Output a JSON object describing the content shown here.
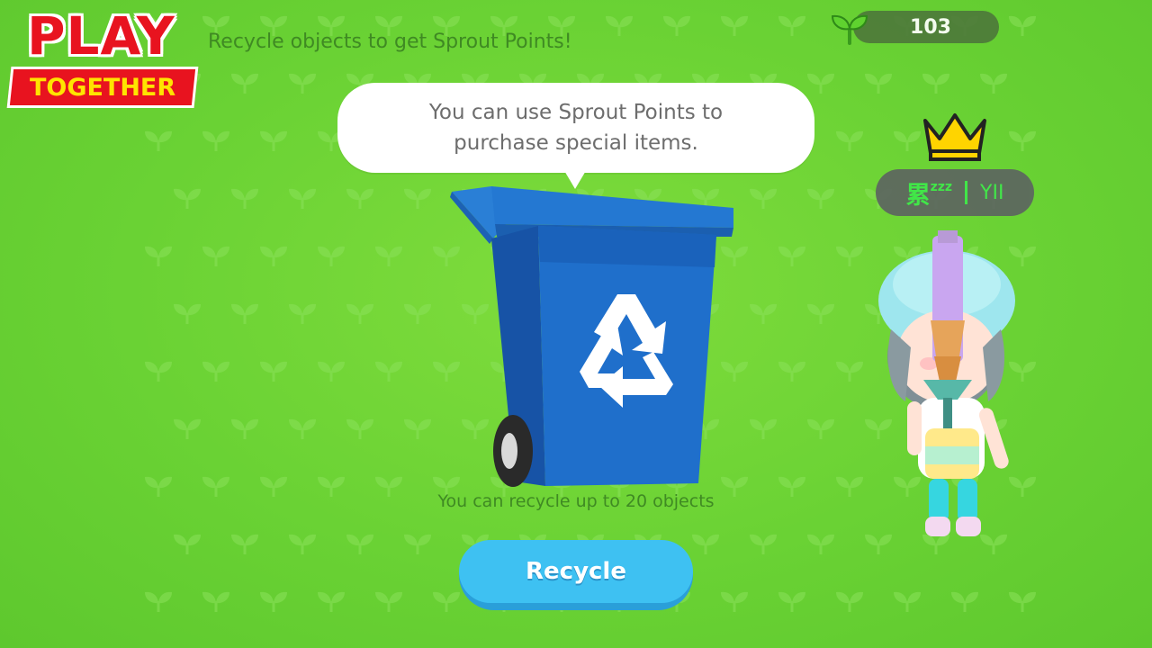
{
  "logo": {
    "line1": "PLAY",
    "line2": "TOGETHER"
  },
  "header": {
    "subtitle": "Recycle objects to get Sprout Points!"
  },
  "sprout_points": {
    "value": "103",
    "icon": "sprout-icon"
  },
  "tooltip": {
    "text": "You can use Sprout Points to purchase special items."
  },
  "recycle_bin": {
    "icon": "recycle-icon"
  },
  "info": {
    "text": "You can recycle up to 20 objects"
  },
  "actions": {
    "recycle_label": "Recycle"
  },
  "player": {
    "name_main": "累",
    "name_zzz": "zzz",
    "name_rest": "YII",
    "badge": "crown-icon"
  },
  "colors": {
    "background": "#6ad234",
    "accent_blue": "#3ec1f2",
    "bin_blue": "#1f6ec9",
    "logo_red": "#e8131f",
    "logo_yellow": "#ffe400",
    "name_green": "#3ee84a"
  }
}
